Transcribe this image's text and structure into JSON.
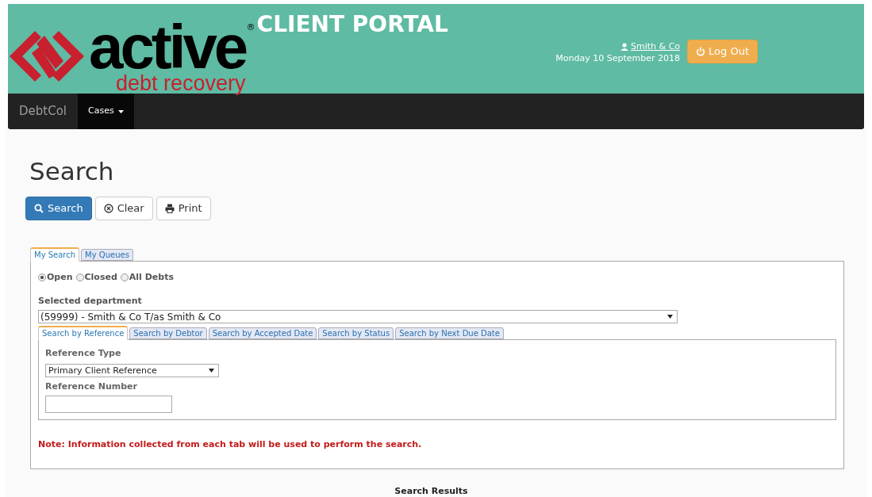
{
  "header": {
    "logo_word": "active",
    "logo_tagline": "debt recovery",
    "registered_mark": "®",
    "portal_title": "CLIENT PORTAL",
    "user_link": "Smith & Co",
    "date": "Monday 10 September 2018",
    "logout_button": "Log Out"
  },
  "navbar": {
    "brand": "DebtCol",
    "menu": [
      {
        "label": "Cases",
        "selected": true
      }
    ]
  },
  "page_title": "Search",
  "actions": [
    {
      "label": "Search",
      "kind": "primary"
    },
    {
      "label": "Clear",
      "kind": "clear"
    },
    {
      "label": "Print",
      "kind": "print"
    }
  ],
  "tabs": [
    {
      "label": "My Search",
      "selected": true
    },
    {
      "label": "My Queues",
      "selected": false
    }
  ],
  "status_options": [
    {
      "label": "Open",
      "selected": true
    },
    {
      "label": "Closed",
      "selected": false
    },
    {
      "label": "All Debts",
      "selected": false
    }
  ],
  "department": {
    "label": "Selected department",
    "value": "(59999) - Smith & Co T/as Smith & Co"
  },
  "search_tabs": [
    {
      "label": "Search by Reference",
      "selected": true
    },
    {
      "label": "Search by Debtor",
      "selected": false
    },
    {
      "label": "Search by Accepted Date",
      "selected": false
    },
    {
      "label": "Search by Status",
      "selected": false
    },
    {
      "label": "Search by Next Due Date",
      "selected": false
    }
  ],
  "reference_type": {
    "label": "Reference Type",
    "value": "Primary Client Reference"
  },
  "reference_number": {
    "label": "Reference Number"
  },
  "note": "Note: Information collected from each tab will be used to perform the search.",
  "results_heading": "Search Results"
}
